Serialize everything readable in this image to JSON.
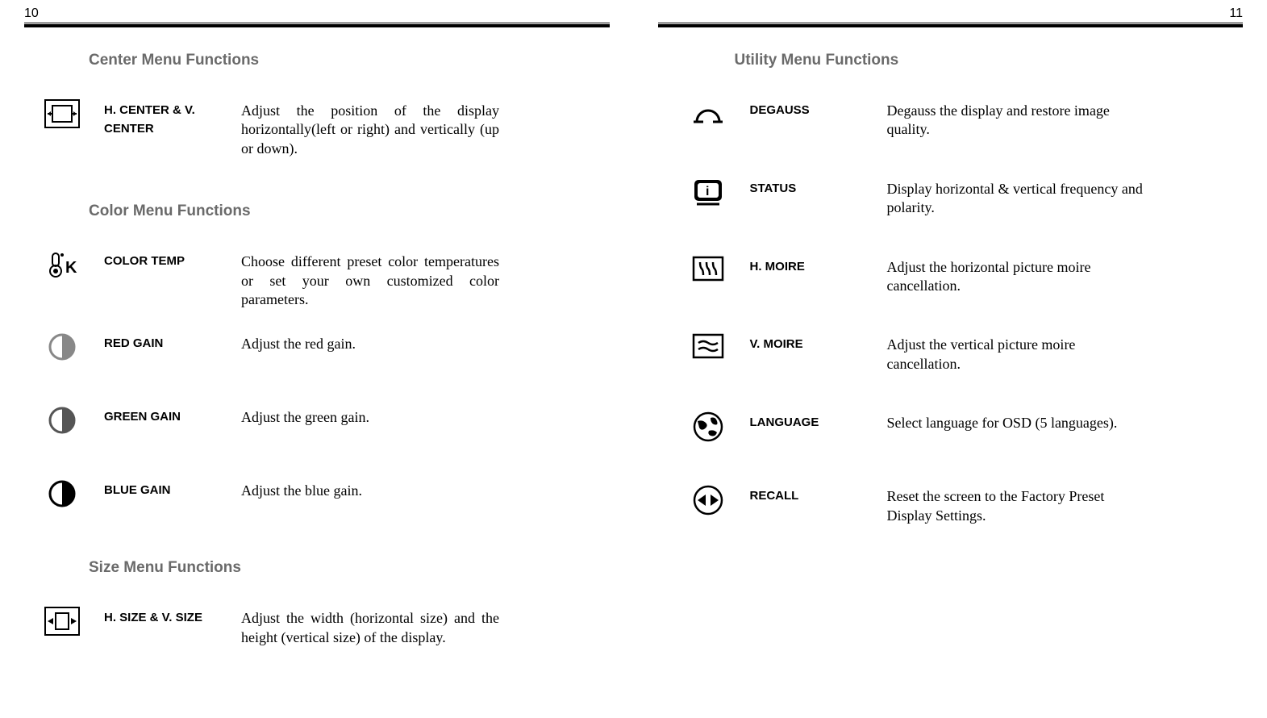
{
  "pages": {
    "left_number": "10",
    "right_number": "11"
  },
  "left": {
    "section1": {
      "heading": "Center Menu Functions",
      "items": [
        {
          "label": "H. CENTER & V. CENTER",
          "desc": "Adjust the position of the display horizontally(left or right) and vertically (up  or down)."
        }
      ]
    },
    "section2": {
      "heading": "Color Menu Functions",
      "items": [
        {
          "label": "COLOR TEMP",
          "desc": "Choose different preset color temperatures or set your own customized color parameters."
        },
        {
          "label": "RED GAIN",
          "desc": "Adjust the red gain."
        },
        {
          "label": "GREEN GAIN",
          "desc": "Adjust the green gain."
        },
        {
          "label": "BLUE GAIN",
          "desc": "Adjust the blue gain."
        }
      ]
    },
    "section3": {
      "heading": "Size Menu Functions",
      "items": [
        {
          "label": "H. SIZE & V. SIZE",
          "desc": "Adjust the width (horizontal size) and the height (vertical size) of the display."
        }
      ]
    }
  },
  "right": {
    "section1": {
      "heading": "Utility Menu Functions",
      "items": [
        {
          "label": "DEGAUSS",
          "desc": "Degauss the display and restore image quality."
        },
        {
          "label": "STATUS",
          "desc": "Display horizontal & vertical frequency and polarity."
        },
        {
          "label": "H. MOIRE",
          "desc": "Adjust the horizontal picture moire cancellation."
        },
        {
          "label": "V. MOIRE",
          "desc": "Adjust the vertical picture moire cancellation."
        },
        {
          "label": "LANGUAGE",
          "desc": "Select language for OSD (5 languages)."
        },
        {
          "label": "RECALL",
          "desc": "Reset the screen to the Factory Preset Display Settings."
        }
      ]
    }
  }
}
